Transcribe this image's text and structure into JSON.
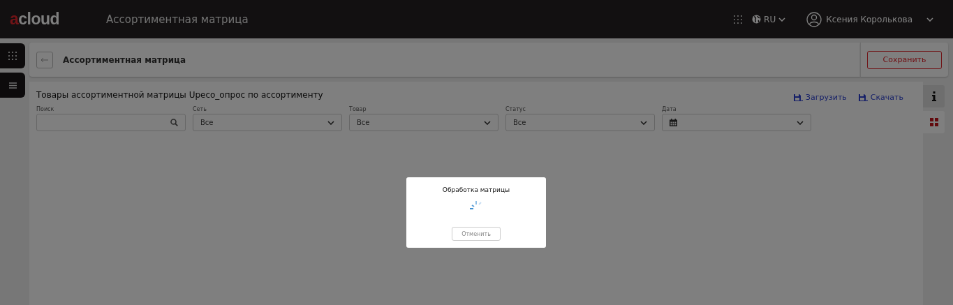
{
  "header": {
    "logo": "acloud",
    "title": "Ассортиментная матрица",
    "language": "RU",
    "user": "Ксения Королькова"
  },
  "page": {
    "title": "Ассортиментная матрица",
    "save_button": "Сохранить"
  },
  "panel": {
    "title": "Товары ассортиментной матрицы Upeco_опрос по ассортименту",
    "actions": [
      "Загрузить",
      "Скачать"
    ],
    "filters": [
      {
        "kind": "search",
        "label": "Поиск"
      },
      {
        "kind": "select",
        "label": "Сеть",
        "value": "Все"
      },
      {
        "kind": "select",
        "label": "Товар",
        "value": "Все"
      },
      {
        "kind": "select",
        "label": "Статус",
        "value": "Все"
      },
      {
        "kind": "date",
        "label": "Дата"
      }
    ]
  },
  "side_tabs": [
    {
      "kind": "info",
      "selected": true
    },
    {
      "kind": "grid",
      "selected": false
    }
  ],
  "dialog": {
    "title": "Обработка матрицы",
    "cancel_button": "Отменить"
  }
}
